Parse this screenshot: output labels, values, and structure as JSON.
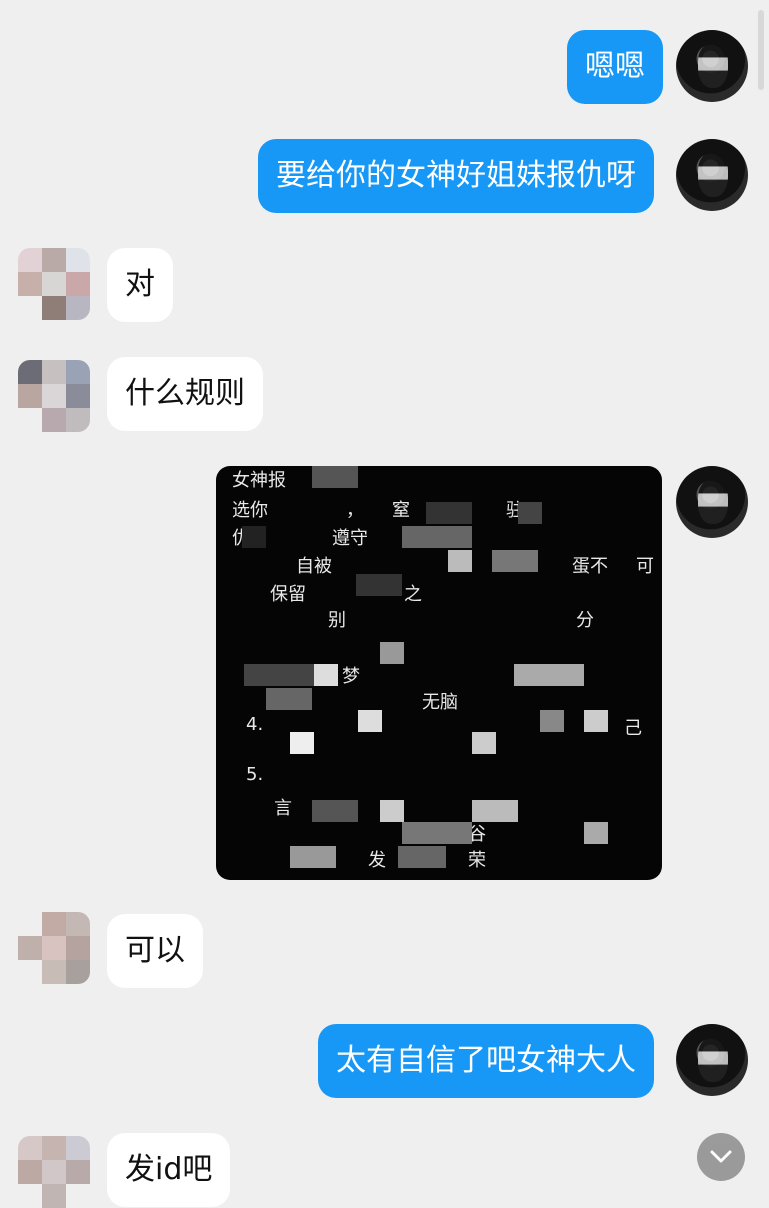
{
  "messages": [
    {
      "side": "me",
      "text": "嗯嗯"
    },
    {
      "side": "me",
      "text": "要给你的女神好姐妹报仇呀"
    },
    {
      "side": "other",
      "text": "对"
    },
    {
      "side": "other",
      "text": "什么规则"
    },
    {
      "side": "me",
      "type": "image",
      "visible_text": [
        "女神报",
        "选你",
        "，",
        "窒",
        "驻",
        "仇",
        "遵守",
        "自被",
        "蛋不",
        "可",
        "保留",
        "之",
        "别",
        "分",
        "梦",
        "无脑",
        "4.",
        "己",
        "5.",
        "言",
        "谷",
        "发",
        "荣"
      ]
    },
    {
      "side": "other",
      "text": "可以"
    },
    {
      "side": "me",
      "text": "太有自信了吧女神大人"
    },
    {
      "side": "other",
      "text": "发id吧"
    }
  ],
  "colors": {
    "background": "#efefef",
    "my_bubble": "#1898f6",
    "their_bubble": "#ffffff"
  },
  "icons": {
    "scroll_down": "chevron-down-icon"
  }
}
